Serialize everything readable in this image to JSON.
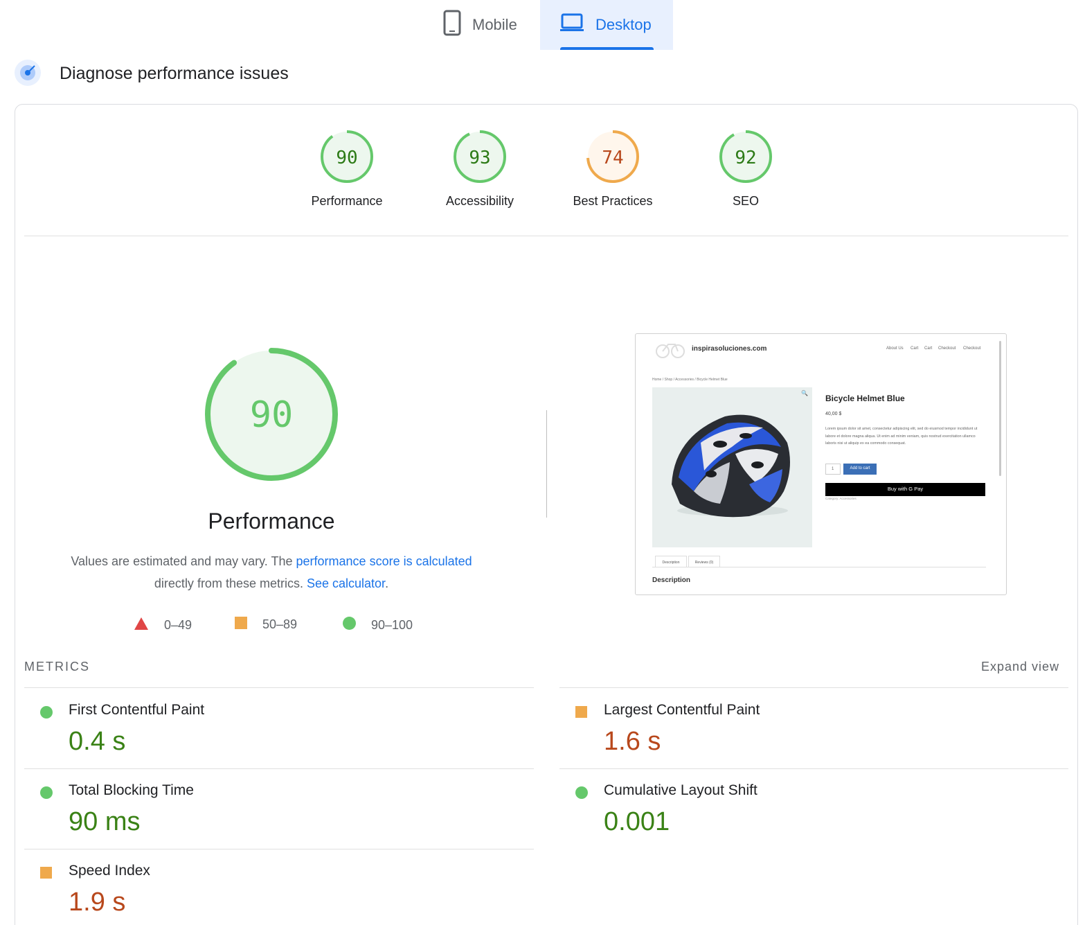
{
  "tabs": [
    {
      "label": "Mobile",
      "icon": "smartphone-icon",
      "selected": false
    },
    {
      "label": "Desktop",
      "icon": "laptop-icon",
      "selected": true
    }
  ],
  "header": {
    "title": "Diagnose performance issues",
    "icon": "diagnose-target-icon"
  },
  "scores": [
    {
      "value": "90",
      "label": "Performance",
      "status": "pass"
    },
    {
      "value": "93",
      "label": "Accessibility",
      "status": "pass"
    },
    {
      "value": "74",
      "label": "Best Practices",
      "status": "average"
    },
    {
      "value": "92",
      "label": "SEO",
      "status": "pass"
    }
  ],
  "main_gauge": {
    "value": "90",
    "title": "Performance"
  },
  "description": {
    "text1": "Values are estimated and may vary. The ",
    "link1": "performance score is calculated",
    "text2": " directly from these metrics. ",
    "link2": "See calculator",
    "text3": "."
  },
  "legend": [
    {
      "shape": "triangle",
      "range": "0–49"
    },
    {
      "shape": "square",
      "range": "50–89"
    },
    {
      "shape": "circle",
      "range": "90–100"
    }
  ],
  "screenshot": {
    "site_name": "inspirasoluciones.com",
    "nav": [
      "About Us",
      "Cart",
      "Cart",
      "Checkout",
      "Checkout"
    ],
    "breadcrumb": "Home / Shop / Accessories / Bicycle Helmet Blue",
    "product_title": "Bicycle Helmet Blue",
    "price": "40,00 $",
    "lorem": "Lorem ipsum dolor sit amet, consectetur adipiscing elit, sed do eiusmod tempor incididunt ut labore et dolore magna aliqua. Ut enim ad minim veniam, quis nostrud exercitation ullamco laboris nisi ut aliquip ex ea commodo consequat.",
    "qty": "1",
    "add_to_cart": "Add to cart",
    "gpay": "Buy with G Pay",
    "category": "Category: Accessories",
    "tab_description": "Description",
    "tab_reviews": "Reviews (0)",
    "section_title": "Description"
  },
  "metrics": {
    "heading": "METRICS",
    "expand": "Expand view",
    "items": [
      {
        "label": "First Contentful Paint",
        "value": "0.4 s",
        "status": "good"
      },
      {
        "label": "Largest Contentful Paint",
        "value": "1.6 s",
        "status": "average"
      },
      {
        "label": "Total Blocking Time",
        "value": "90 ms",
        "status": "good"
      },
      {
        "label": "Cumulative Layout Shift",
        "value": "0.001",
        "status": "good"
      },
      {
        "label": "Speed Index",
        "value": "1.9 s",
        "status": "average"
      }
    ]
  },
  "colors": {
    "pass": "#0cce6b",
    "average": "#ffa400",
    "fail": "#ff4e42",
    "accent": "#1a73e8"
  }
}
